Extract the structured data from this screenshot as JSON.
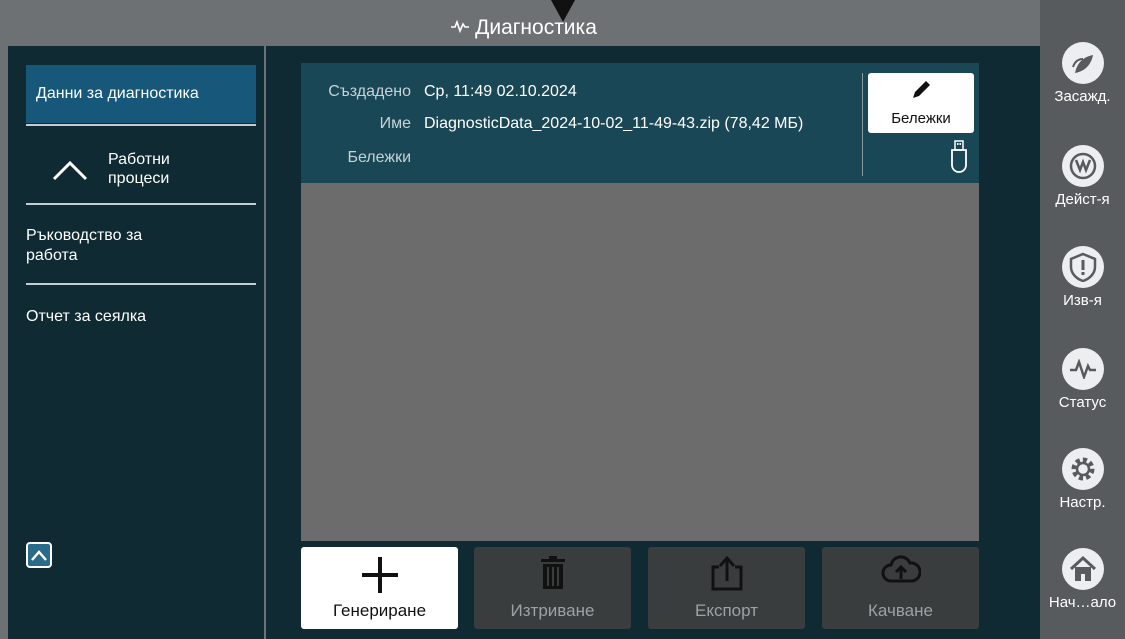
{
  "title": {
    "icon": "pulse-icon",
    "text": "Диагностика"
  },
  "sidebar": {
    "items": [
      {
        "label": "Данни за диагностика",
        "selected": true
      },
      {
        "label": "Работни процеси",
        "icon": "chevron-up-icon"
      },
      {
        "label": "Ръководство за работа"
      },
      {
        "label": "Отчет за сеялка"
      }
    ],
    "collapse_icon": "collapse-up-icon"
  },
  "info": {
    "created_label": "Създадено",
    "created_value": "Ср, 11:49 02.10.2024",
    "name_label": "Име",
    "name_value": "DiagnosticData_2024-10-02_11-49-43.zip (78,42 МБ)",
    "notes_label": "Бележки",
    "notes_value": "",
    "notes_button": "Бележки",
    "usb_icon": "usb-drive-icon"
  },
  "actions": [
    {
      "label": "Генериране",
      "icon": "plus-icon",
      "enabled": true
    },
    {
      "label": "Изтриване",
      "icon": "trash-icon",
      "enabled": false
    },
    {
      "label": "Експорт",
      "icon": "export-icon",
      "enabled": false
    },
    {
      "label": "Качване",
      "icon": "cloud-upload-icon",
      "enabled": false
    }
  ],
  "rail": [
    {
      "label": "Засажд.",
      "icon": "planting-icon"
    },
    {
      "label": "Дейст-я",
      "icon": "actions-icon"
    },
    {
      "label": "Изв-я",
      "icon": "alerts-icon"
    },
    {
      "label": "Статус",
      "icon": "status-pulse-icon"
    },
    {
      "label": "Настр.",
      "icon": "settings-gear-icon"
    },
    {
      "label": "Нач…ало",
      "icon": "home-icon"
    }
  ],
  "colors": {
    "background": "#0f2a33",
    "frame": "#6e7173",
    "selected": "#16577a",
    "info_panel": "#194756",
    "list_area": "#6b6c6b",
    "rail": "#585b5d"
  }
}
